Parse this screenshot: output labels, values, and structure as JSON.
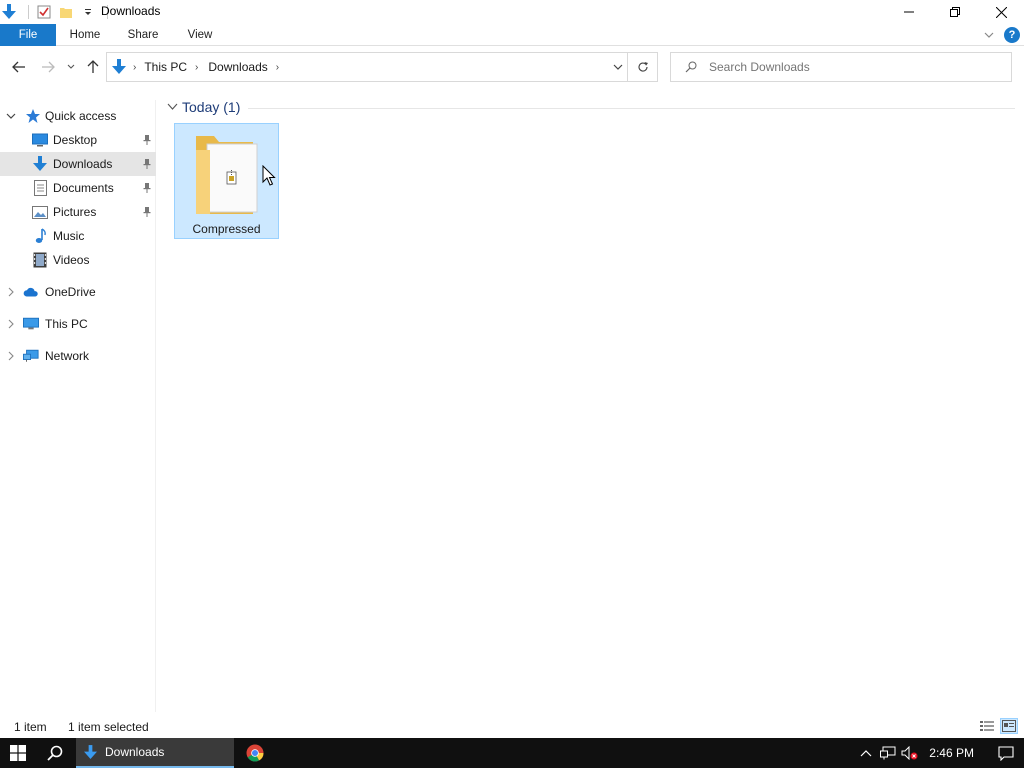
{
  "window": {
    "title": "Downloads"
  },
  "ribbon": {
    "tabs": [
      "File",
      "Home",
      "Share",
      "View"
    ]
  },
  "address": {
    "crumbs": [
      "This PC",
      "Downloads"
    ]
  },
  "search": {
    "placeholder": "Search Downloads"
  },
  "nav": {
    "quick_access": "Quick access",
    "items": [
      {
        "label": "Desktop",
        "icon": "desktop-icon",
        "pinned": true
      },
      {
        "label": "Downloads",
        "icon": "downloads-icon",
        "pinned": true,
        "selected": true
      },
      {
        "label": "Documents",
        "icon": "documents-icon",
        "pinned": true
      },
      {
        "label": "Pictures",
        "icon": "pictures-icon",
        "pinned": true
      },
      {
        "label": "Music",
        "icon": "music-icon",
        "pinned": false
      },
      {
        "label": "Videos",
        "icon": "videos-icon",
        "pinned": false
      }
    ],
    "onedrive": "OneDrive",
    "thispc": "This PC",
    "network": "Network"
  },
  "content": {
    "group_label": "Today (1)",
    "files": [
      {
        "name": "Compressed",
        "type": "zipped-folder",
        "selected": true
      }
    ]
  },
  "status": {
    "count": "1 item",
    "selection": "1 item selected"
  },
  "taskbar": {
    "app_label": "Downloads",
    "time": "2:46 PM"
  },
  "colors": {
    "accent": "#1979ca",
    "selection_bg": "#cce8ff",
    "selection_border": "#99d1ff",
    "nav_selected": "#e5e5e5",
    "taskbar": "#101010"
  }
}
